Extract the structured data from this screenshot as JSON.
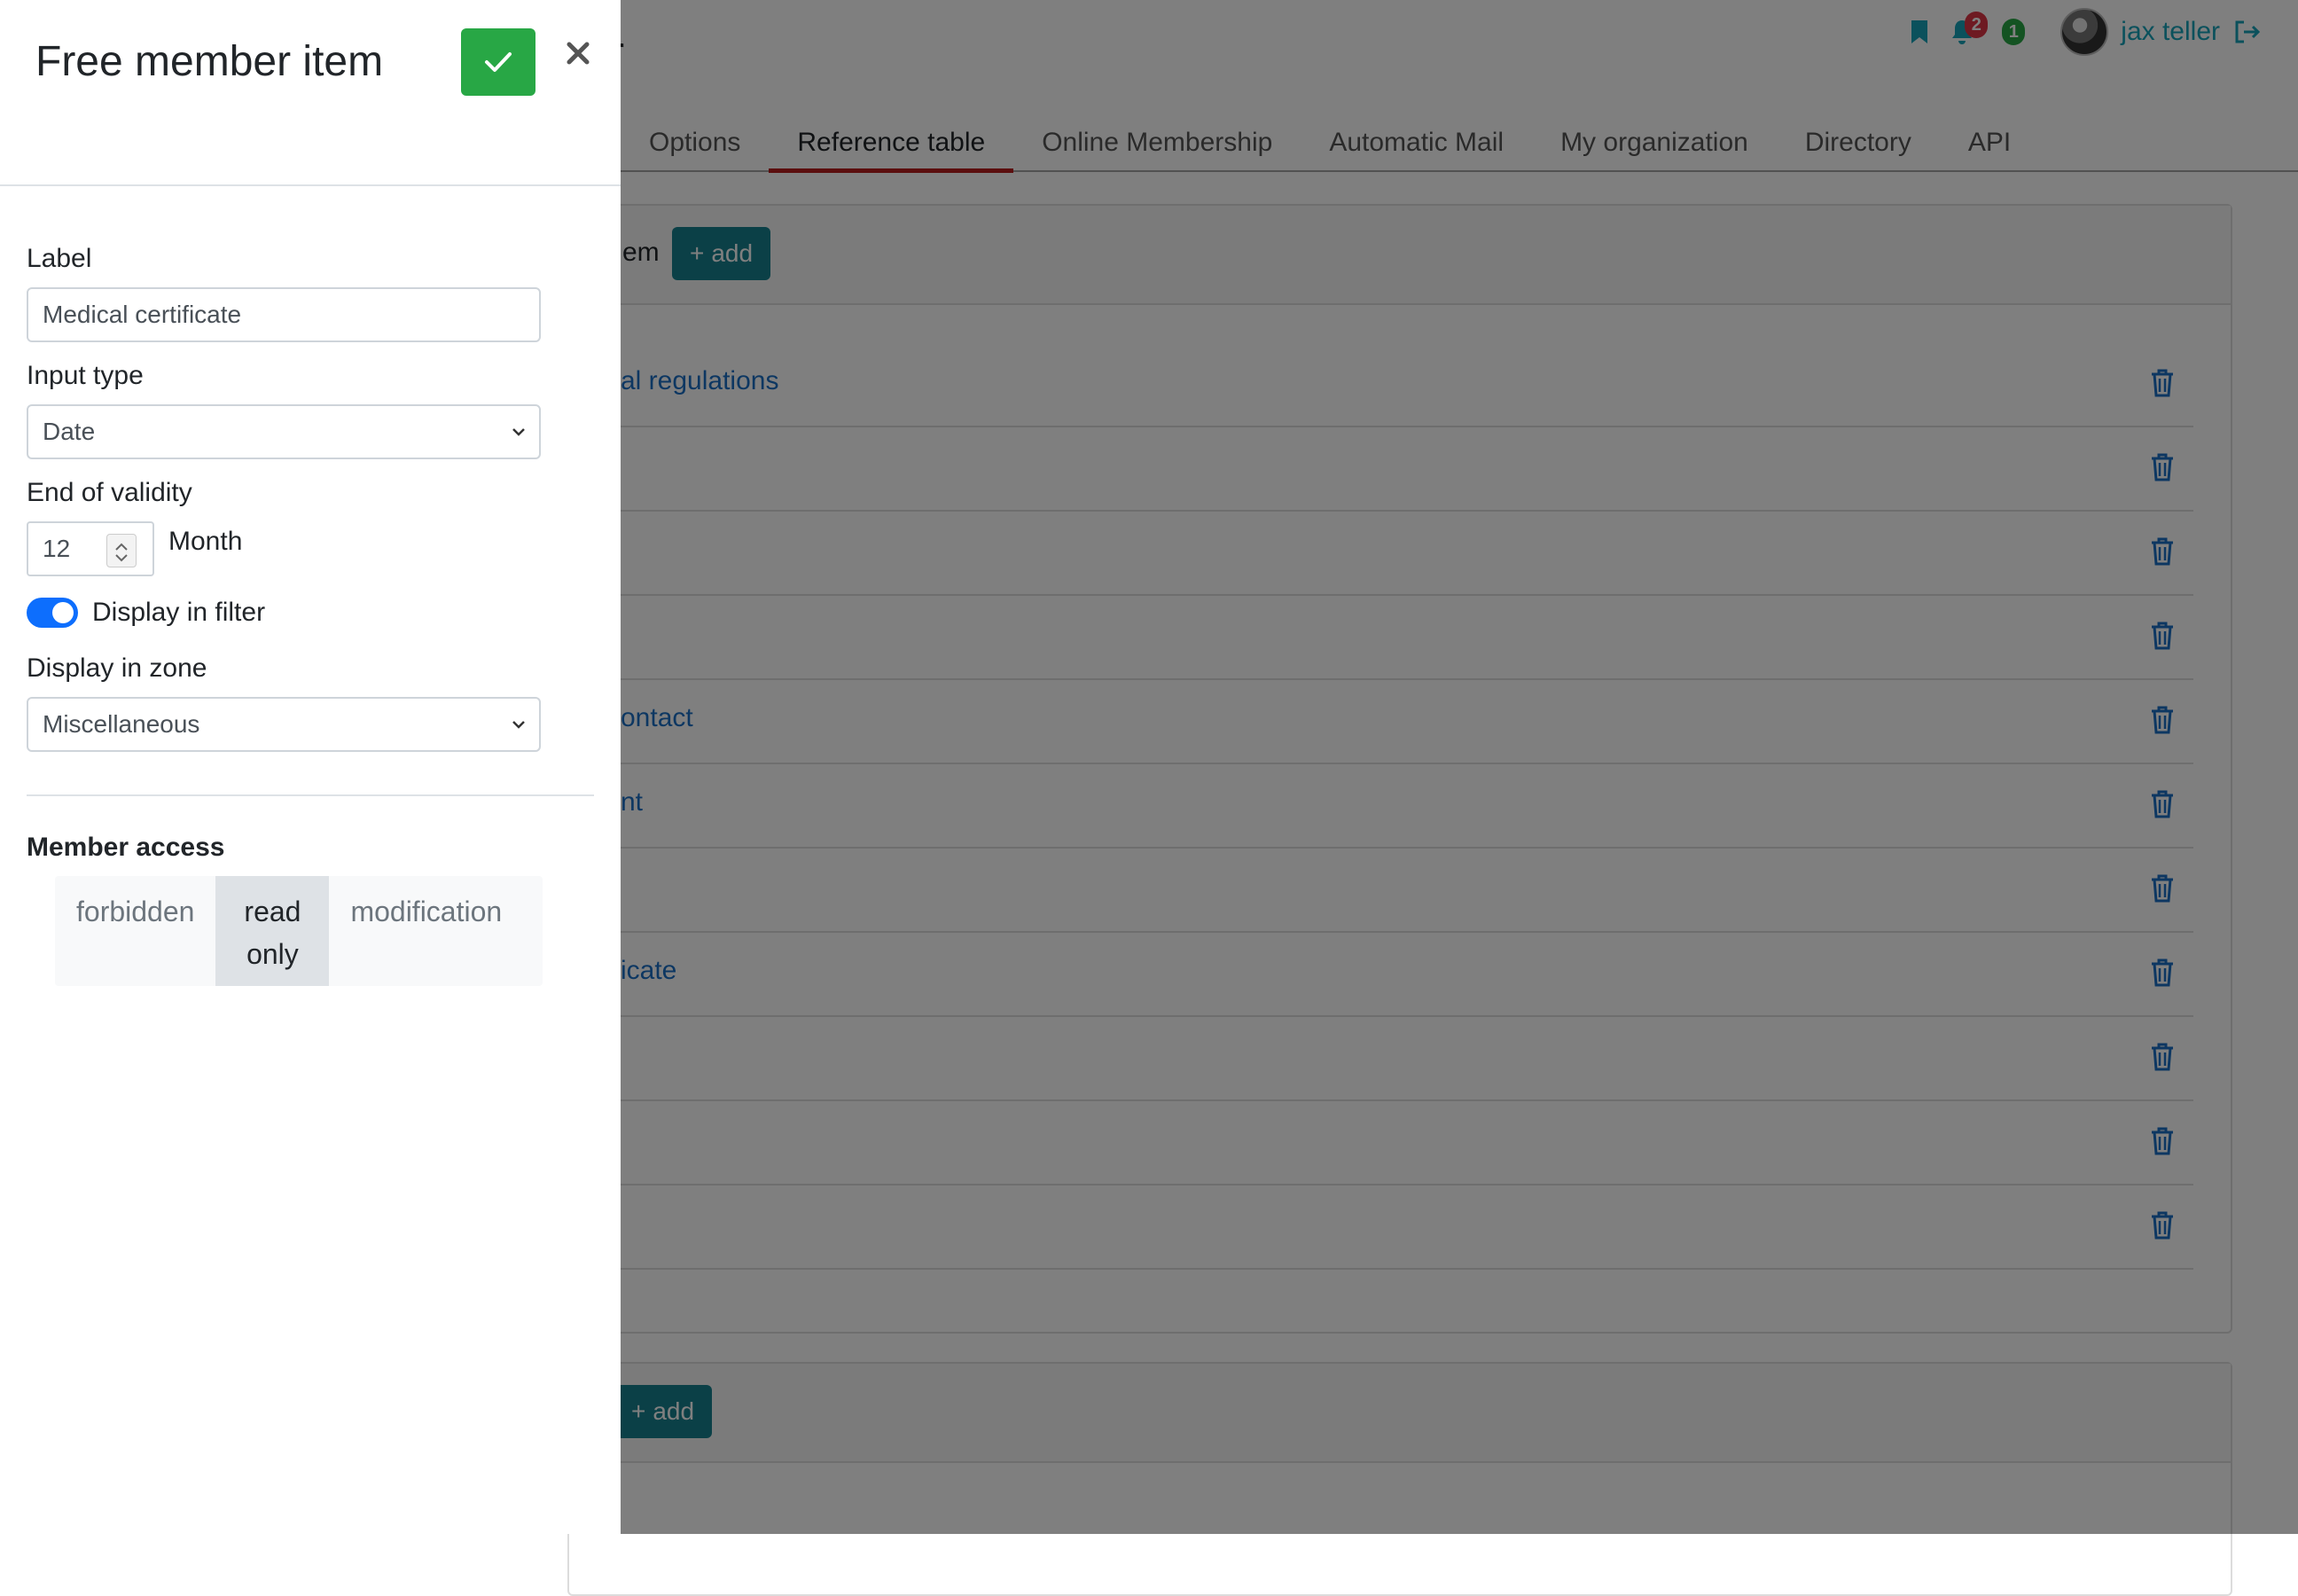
{
  "background": {
    "page_title_fragment": "r",
    "topbar": {
      "notification_count": "2",
      "status_count": "1",
      "user_name": "jax teller"
    },
    "tabs": [
      {
        "label": "Options",
        "active": false
      },
      {
        "label": "Reference table",
        "active": true
      },
      {
        "label": "Online Membership",
        "active": false
      },
      {
        "label": "Automatic Mail",
        "active": false
      },
      {
        "label": "My organization",
        "active": false
      },
      {
        "label": "Directory",
        "active": false
      },
      {
        "label": "API",
        "active": false
      }
    ],
    "card1": {
      "header_fragment": "em",
      "add_label": "add",
      "rows": [
        {
          "label": "al regulations"
        },
        {
          "label": ""
        },
        {
          "label": ""
        },
        {
          "label": ""
        },
        {
          "label": "ontact"
        },
        {
          "label": "nt"
        },
        {
          "label": ""
        },
        {
          "label": "icate"
        },
        {
          "label": ""
        },
        {
          "label": ""
        },
        {
          "label": ""
        }
      ]
    },
    "card2": {
      "add_label": "add"
    },
    "colors": {
      "accent_teal": "#17818f",
      "active_tab_underline": "#b71c1c",
      "link_blue": "#1a6fc4"
    }
  },
  "panel": {
    "title": "Free member item",
    "colors": {
      "confirm": "#28a745",
      "toggle_on": "#0d6efd"
    },
    "fields": {
      "label": {
        "label": "Label",
        "value": "Medical certificate"
      },
      "input_type": {
        "label": "Input type",
        "value": "Date"
      },
      "end_of_validity": {
        "label": "End of validity",
        "value": "12",
        "unit": "Month"
      },
      "display_in_filter": {
        "label": "Display in filter",
        "checked": true
      },
      "display_in_zone": {
        "label": "Display in zone",
        "value": "Miscellaneous"
      }
    },
    "member_access": {
      "title": "Member access",
      "options": [
        {
          "label": "forbidden",
          "selected": false
        },
        {
          "label": "read only",
          "selected": true
        },
        {
          "label": "modification",
          "selected": false
        }
      ]
    }
  }
}
